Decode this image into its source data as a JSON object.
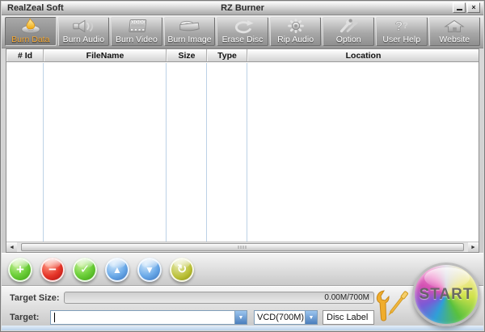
{
  "window": {
    "app_title": "RealZeal Soft",
    "title": "RZ Burner",
    "close_glyph": "×"
  },
  "toolbar": {
    "buttons": [
      {
        "label": "Burn Data",
        "icon": "disc-flame-icon",
        "active": true
      },
      {
        "label": "Burn Audio",
        "icon": "speaker-icon",
        "active": false
      },
      {
        "label": "Burn Video",
        "icon": "filmstrip-icon",
        "active": false
      },
      {
        "label": "Burn Image",
        "icon": "disc-drive-icon",
        "active": false
      },
      {
        "label": "Erase Disc",
        "icon": "circular-arrow-icon",
        "active": false
      },
      {
        "label": "Rip Audio",
        "icon": "gear-icon",
        "active": false
      },
      {
        "label": "Option",
        "icon": "tools-icon",
        "active": false
      },
      {
        "label": "User Help",
        "icon": "question-mark-icon",
        "active": false
      },
      {
        "label": "Website",
        "icon": "home-icon",
        "active": false
      }
    ]
  },
  "file_table": {
    "columns": [
      "# Id",
      "FileName",
      "Size",
      "Type",
      "Location"
    ],
    "rows": []
  },
  "scrollbar": {
    "left_arrow": "◄",
    "right_arrow": "►"
  },
  "action_buttons": [
    {
      "name": "add-file-button",
      "icon": "plus-icon",
      "glyph": "+",
      "color": "#3fa414"
    },
    {
      "name": "remove-file-button",
      "icon": "minus-icon",
      "glyph": "−",
      "color": "#b31414"
    },
    {
      "name": "confirm-button",
      "icon": "check-icon",
      "glyph": "✓",
      "color": "#3fa414"
    },
    {
      "name": "move-up-button",
      "icon": "up-arrow-icon",
      "glyph": "▲",
      "color": "#3c77c0"
    },
    {
      "name": "move-down-button",
      "icon": "down-arrow-icon",
      "glyph": "▼",
      "color": "#3c77c0"
    },
    {
      "name": "refresh-button",
      "icon": "refresh-icon",
      "glyph": "↻",
      "color": "#8f9414"
    }
  ],
  "status": {
    "target_size_label": "Target Size:",
    "target_size_value": "0.00M/700M",
    "target_label": "Target:",
    "target_value": "",
    "disc_type_value": "VCD(700M)",
    "disc_label_value": "Disc Label",
    "dropdown_arrow": "▼"
  },
  "start_button": {
    "label": "START"
  },
  "colors": {
    "active_button_text": "#f6a832",
    "column_divider": "#bdd2e6",
    "dropdown_button": "#4a7ebc",
    "tools_gold": "#f0ad2c"
  }
}
